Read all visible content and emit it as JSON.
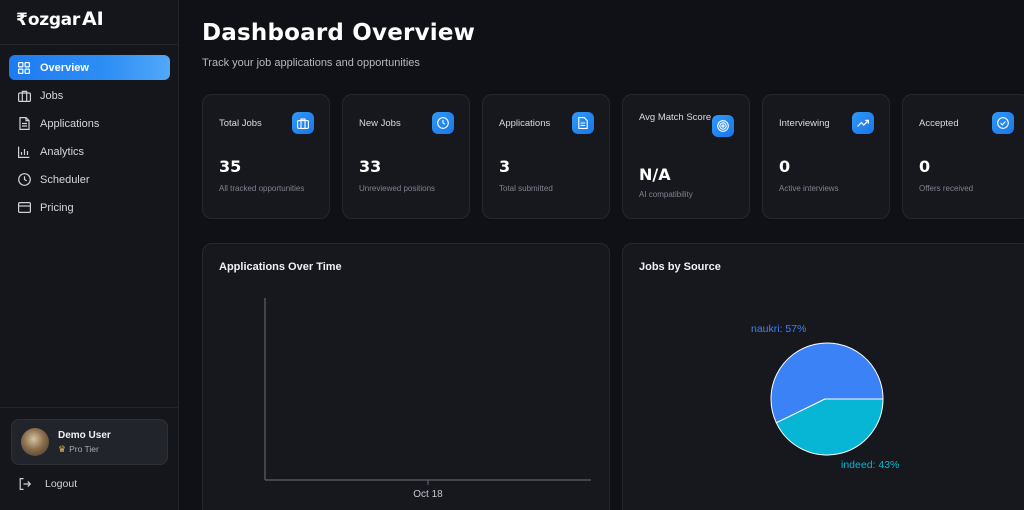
{
  "brand": {
    "rupee": "₹",
    "word": "ozgar",
    "ai": "AI"
  },
  "nav": [
    {
      "label": "Overview",
      "icon": "grid-icon",
      "active": true
    },
    {
      "label": "Jobs",
      "icon": "briefcase-icon"
    },
    {
      "label": "Applications",
      "icon": "document-icon"
    },
    {
      "label": "Analytics",
      "icon": "bar-chart-icon"
    },
    {
      "label": "Scheduler",
      "icon": "clock-icon"
    },
    {
      "label": "Pricing",
      "icon": "credit-card-icon"
    }
  ],
  "user": {
    "name": "Demo User",
    "tier": "Pro Tier"
  },
  "logout": {
    "label": "Logout"
  },
  "header": {
    "title": "Dashboard Overview",
    "subtitle": "Track your job applications and opportunities"
  },
  "stats": [
    {
      "label": "Total Jobs",
      "value": "35",
      "desc": "All tracked opportunities",
      "icon": "briefcase-icon"
    },
    {
      "label": "New Jobs",
      "value": "33",
      "desc": "Unreviewed positions",
      "icon": "clock-icon"
    },
    {
      "label": "Applications",
      "value": "3",
      "desc": "Total submitted",
      "icon": "document-icon"
    },
    {
      "label": "Avg Match Score",
      "value": "N/A",
      "desc": "AI compatibility",
      "icon": "target-icon"
    },
    {
      "label": "Interviewing",
      "value": "0",
      "desc": "Active interviews",
      "icon": "trending-up-icon"
    },
    {
      "label": "Accepted",
      "value": "0",
      "desc": "Offers received",
      "icon": "check-circle-icon"
    }
  ],
  "colors": {
    "accent": "#1d7cf2",
    "pie_naukri": "#3b82f6",
    "pie_indeed": "#06b6d4",
    "background": "#101116",
    "card": "#17181e"
  },
  "panels": {
    "applications_over_time": {
      "title": "Applications Over Time"
    },
    "jobs_by_source": {
      "title": "Jobs by Source"
    }
  },
  "chart_data": [
    {
      "type": "line",
      "title": "Applications Over Time",
      "x": [
        "Oct 18"
      ],
      "series": [],
      "xlabel": "",
      "ylabel": "",
      "grid": false
    },
    {
      "type": "pie",
      "title": "Jobs by Source",
      "slices": [
        {
          "label": "naukri: 57%",
          "name": "naukri",
          "value": 57,
          "color": "#3b82f6"
        },
        {
          "label": "indeed: 43%",
          "name": "indeed",
          "value": 43,
          "color": "#06b6d4"
        }
      ]
    }
  ]
}
